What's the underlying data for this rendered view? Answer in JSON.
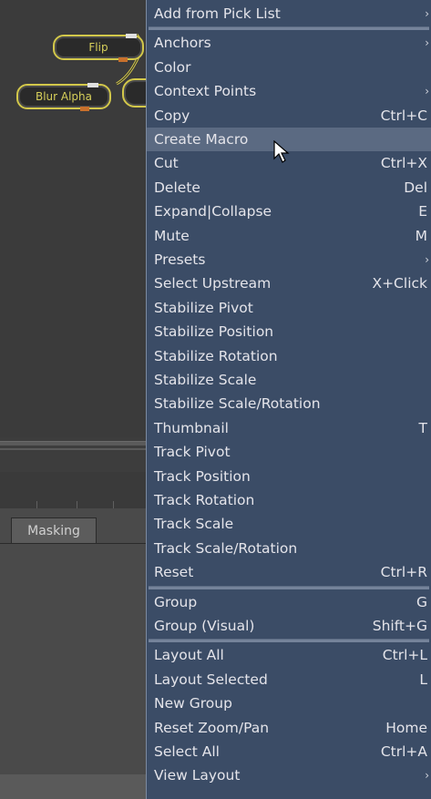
{
  "canvas": {
    "nodes": [
      {
        "label": "Flip"
      },
      {
        "label": "Blur Alpha"
      }
    ],
    "masking_tab": "Masking"
  },
  "menu": {
    "items": [
      {
        "label": "Add from Pick List",
        "shortcut": "",
        "submenu": true
      },
      {
        "label": "Anchors",
        "shortcut": "",
        "submenu": true
      },
      {
        "label": "Color",
        "shortcut": "",
        "submenu": false
      },
      {
        "label": "Context Points",
        "shortcut": "",
        "submenu": true
      },
      {
        "label": "Copy",
        "shortcut": "Ctrl+C",
        "submenu": false
      },
      {
        "label": "Create Macro",
        "shortcut": "",
        "submenu": false,
        "highlighted": true
      },
      {
        "label": "Cut",
        "shortcut": "Ctrl+X",
        "submenu": false
      },
      {
        "label": "Delete",
        "shortcut": "Del",
        "submenu": false
      },
      {
        "label": "Expand|Collapse",
        "shortcut": "E",
        "submenu": false
      },
      {
        "label": "Mute",
        "shortcut": "M",
        "submenu": false
      },
      {
        "label": "Presets",
        "shortcut": "",
        "submenu": true
      },
      {
        "label": "Select Upstream",
        "shortcut": "X+Click",
        "submenu": false
      },
      {
        "label": "Stabilize Pivot",
        "shortcut": "",
        "submenu": false
      },
      {
        "label": "Stabilize Position",
        "shortcut": "",
        "submenu": false
      },
      {
        "label": "Stabilize Rotation",
        "shortcut": "",
        "submenu": false
      },
      {
        "label": "Stabilize Scale",
        "shortcut": "",
        "submenu": false
      },
      {
        "label": "Stabilize Scale/Rotation",
        "shortcut": "",
        "submenu": false
      },
      {
        "label": "Thumbnail",
        "shortcut": "T",
        "submenu": false
      },
      {
        "label": "Track Pivot",
        "shortcut": "",
        "submenu": false
      },
      {
        "label": "Track Position",
        "shortcut": "",
        "submenu": false
      },
      {
        "label": "Track Rotation",
        "shortcut": "",
        "submenu": false
      },
      {
        "label": "Track Scale",
        "shortcut": "",
        "submenu": false
      },
      {
        "label": "Track Scale/Rotation",
        "shortcut": "",
        "submenu": false
      },
      {
        "label": "Reset",
        "shortcut": "Ctrl+R",
        "submenu": false
      },
      {
        "label": "Group",
        "shortcut": "G",
        "submenu": false
      },
      {
        "label": "Group (Visual)",
        "shortcut": "Shift+G",
        "submenu": false
      },
      {
        "label": "Layout All",
        "shortcut": "Ctrl+L",
        "submenu": false
      },
      {
        "label": "Layout Selected",
        "shortcut": "L",
        "submenu": false
      },
      {
        "label": "New Group",
        "shortcut": "",
        "submenu": false
      },
      {
        "label": "Reset Zoom/Pan",
        "shortcut": "Home",
        "submenu": false
      },
      {
        "label": "Select All",
        "shortcut": "Ctrl+A",
        "submenu": false
      },
      {
        "label": "View Layout",
        "shortcut": "",
        "submenu": true
      }
    ],
    "separators_after": [
      0,
      23,
      25
    ],
    "submenu_glyph": "›"
  },
  "colors": {
    "menu_bg": "#3b4c66",
    "menu_highlight": "#5b6a82",
    "node_outline": "#d3c84a",
    "node_port": "#c8702c"
  }
}
